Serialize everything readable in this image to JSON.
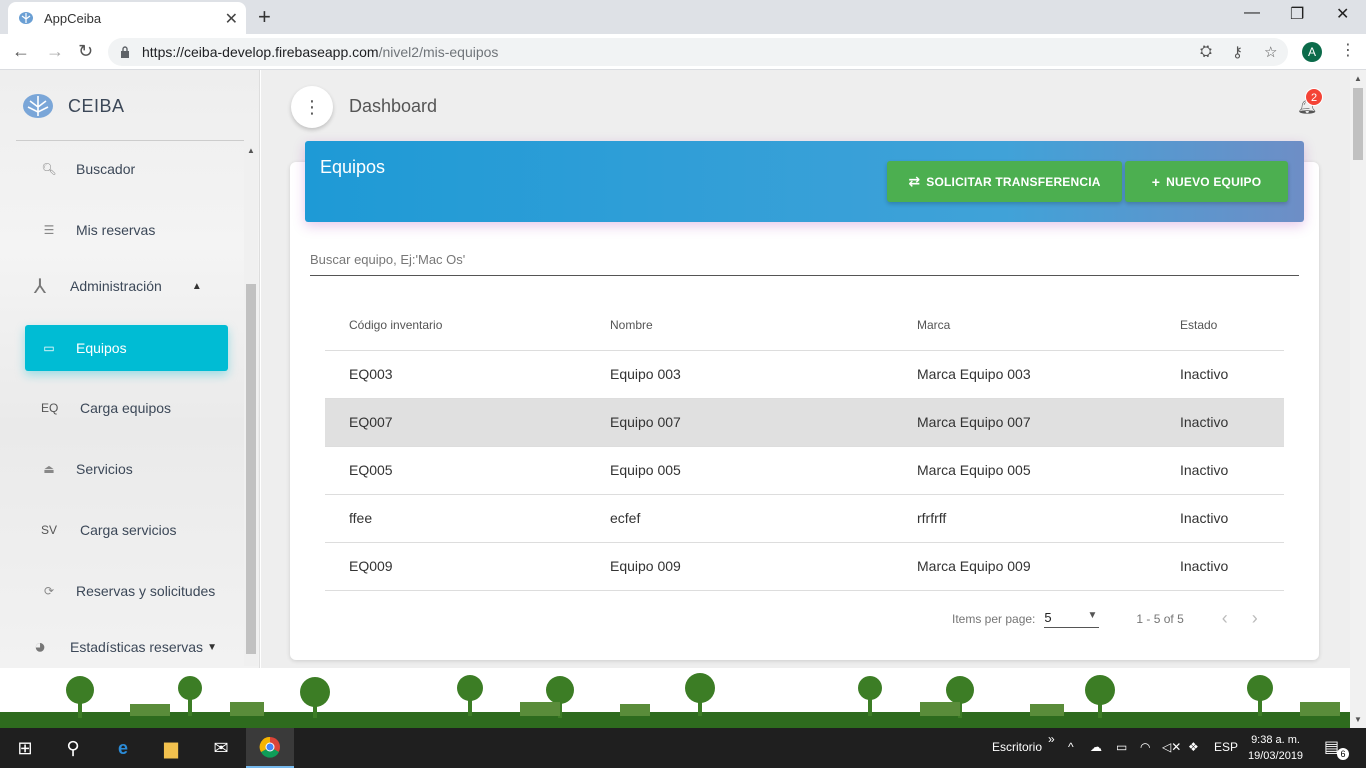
{
  "browser": {
    "tab_title": "AppCeiba",
    "url_host": "https://ceiba-develop.firebaseapp.com",
    "url_path": "/nivel2/mis-equipos",
    "profile_initial": "A"
  },
  "sidebar": {
    "brand": "CEIBA",
    "items": [
      {
        "label": "Buscador",
        "icon": "search-icon"
      },
      {
        "label": "Mis reservas",
        "icon": "list-icon"
      },
      {
        "label": "Administración",
        "icon": "hub-icon"
      },
      {
        "label": "Equipos",
        "icon": "laptop-icon"
      },
      {
        "label": "Carga equipos",
        "abbr": "EQ"
      },
      {
        "label": "Servicios",
        "icon": "eject-icon"
      },
      {
        "label": "Carga servicios",
        "abbr": "SV"
      },
      {
        "label": "Reservas y solicitudes",
        "icon": "sync-icon"
      },
      {
        "label": "Estadísticas reservas",
        "icon": "pie-chart-icon"
      }
    ]
  },
  "header": {
    "title": "Dashboard",
    "notifications": "2"
  },
  "card": {
    "title": "Equipos",
    "transfer_button": "SOLICITAR TRANSFERENCIA",
    "new_button": "NUEVO EQUIPO",
    "search_placeholder": "Buscar equipo, Ej:'Mac Os'"
  },
  "table": {
    "columns": [
      "Código inventario",
      "Nombre",
      "Marca",
      "Estado"
    ],
    "rows": [
      [
        "EQ003",
        "Equipo 003",
        "Marca Equipo 003",
        "Inactivo"
      ],
      [
        "EQ007",
        "Equipo 007",
        "Marca Equipo 007",
        "Inactivo"
      ],
      [
        "EQ005",
        "Equipo 005",
        "Marca Equipo 005",
        "Inactivo"
      ],
      [
        "ffee",
        "ecfef",
        "rfrfrff",
        "Inactivo"
      ],
      [
        "EQ009",
        "Equipo 009",
        "Marca Equipo 009",
        "Inactivo"
      ]
    ]
  },
  "pager": {
    "items_label": "Items per page:",
    "page_size": "5",
    "range": "1 - 5 of 5"
  },
  "taskbar": {
    "desktop_label": "Escritorio",
    "lang": "ESP",
    "time": "9:38 a. m.",
    "date": "19/03/2019",
    "notifications": "6"
  }
}
